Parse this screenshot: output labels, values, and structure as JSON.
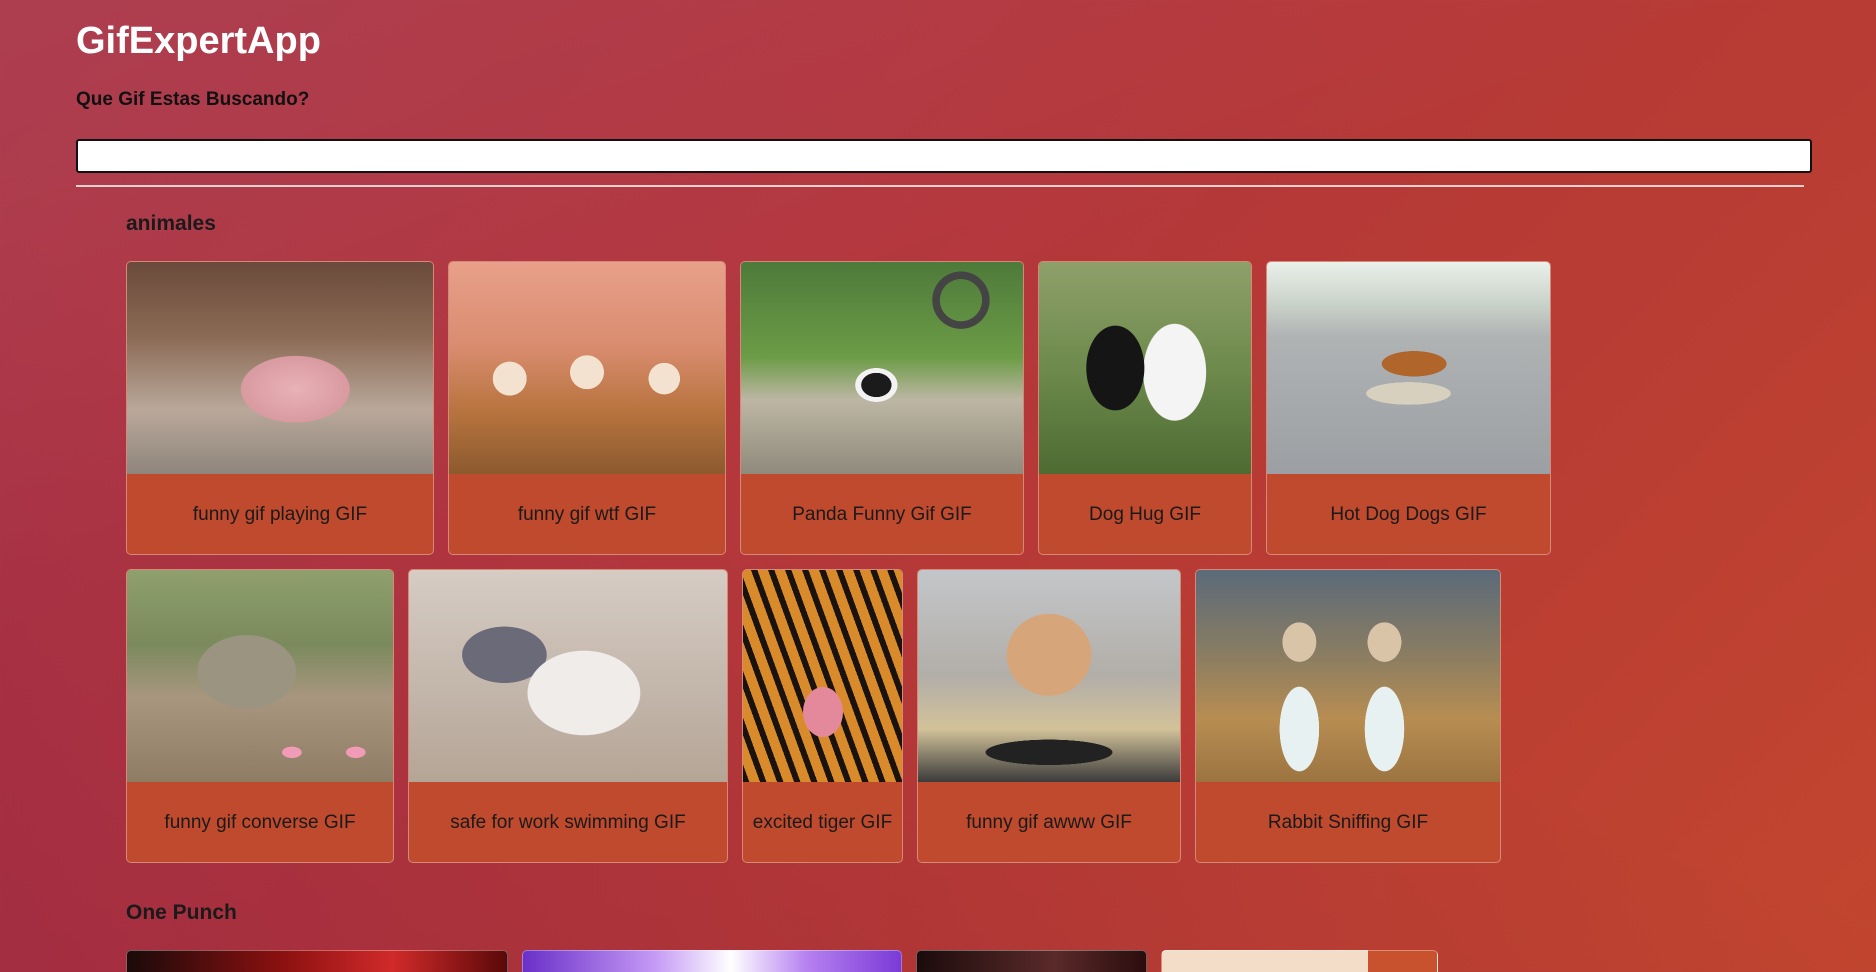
{
  "app": {
    "title": "GifExpertApp",
    "search_label": "Que Gif Estas Buscando?",
    "search_value": ""
  },
  "categories": [
    {
      "name": "animales",
      "gifs": [
        {
          "title": "funny gif playing GIF"
        },
        {
          "title": "funny gif wtf GIF"
        },
        {
          "title": "Panda Funny Gif GIF"
        },
        {
          "title": "Dog Hug GIF"
        },
        {
          "title": "Hot Dog Dogs GIF"
        },
        {
          "title": "funny gif converse GIF"
        },
        {
          "title": "safe for work swimming GIF"
        },
        {
          "title": "excited tiger GIF"
        },
        {
          "title": "funny gif awww GIF"
        },
        {
          "title": "Rabbit Sniffing GIF"
        }
      ]
    },
    {
      "name": "One Punch",
      "gifs": []
    }
  ],
  "colors": {
    "card_background": "#bf4a2d",
    "card_text": "#1a1a1a",
    "heading_text": "#ffffff"
  }
}
